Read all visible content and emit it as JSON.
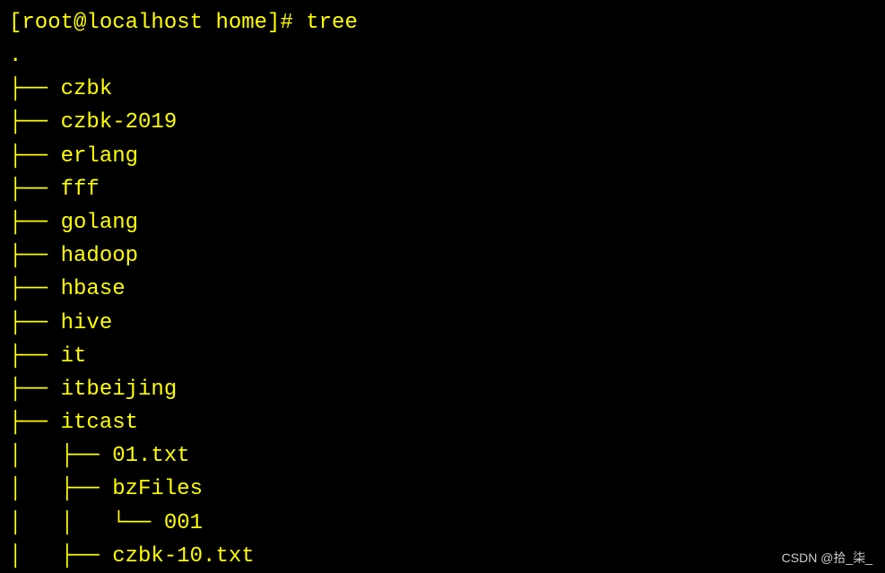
{
  "prompt": {
    "full_text": "[root@localhost home]# tree",
    "user_host": "root@localhost",
    "cwd": "home",
    "symbol": "#",
    "command": "tree"
  },
  "tree": {
    "root_dot": ".",
    "lines": [
      "├── czbk",
      "├── czbk-2019",
      "├── erlang",
      "├── fff",
      "├── golang",
      "├── hadoop",
      "├── hbase",
      "├── hive",
      "├── it",
      "├── itbeijing",
      "├── itcast",
      "│   ├── 01.txt",
      "│   ├── bzFiles",
      "│   │   └── 001",
      "│   ├── czbk-10.txt"
    ]
  },
  "watermark": "CSDN @拾_柒_"
}
